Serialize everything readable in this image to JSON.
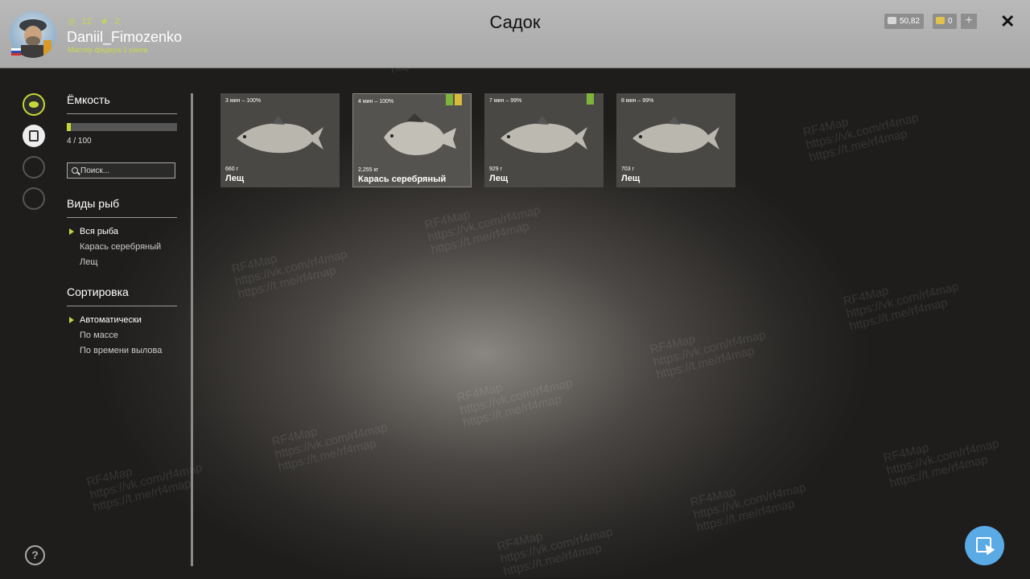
{
  "player": {
    "level": "12",
    "stars": "2",
    "username": "Daniil_Fimozenko",
    "rank": "Мастер фидера 1 ранга"
  },
  "title": "Садок",
  "currency": {
    "silver": "50,82",
    "gold": "0",
    "add": "+"
  },
  "capacity": {
    "title": "Ёмкость",
    "used": 4,
    "max": 100,
    "text": "4 / 100"
  },
  "search": {
    "placeholder": "Поиск..."
  },
  "fish_types": {
    "title": "Виды рыб",
    "items": [
      "Вся рыба",
      "Карась серебряный",
      "Лещ"
    ]
  },
  "sorting": {
    "title": "Сортировка",
    "items": [
      "Автоматически",
      "По массе",
      "По времени вылова"
    ]
  },
  "cards": [
    {
      "time": "3 мин – 100%",
      "weight": "660 г",
      "name": "Лещ"
    },
    {
      "time": "4 мин – 100%",
      "weight": "2,255 кг",
      "name": "Карась серебряный"
    },
    {
      "time": "7 мин – 99%",
      "weight": "929 г",
      "name": "Лещ"
    },
    {
      "time": "8 мин – 99%",
      "weight": "703 г",
      "name": "Лещ"
    }
  ],
  "watermark": {
    "name": "RF4Map",
    "vk": "https://vk.com/rf4map",
    "tg": "https://t.me/rf4map"
  },
  "colors": {
    "accent": "#c6d63a",
    "topbar": "#b0b0b0",
    "help_button": "#5aaae6"
  },
  "icons": [
    "fish-icon",
    "keepnet-icon",
    "trophy-icon",
    "home-icon",
    "help-icon",
    "cursor-icon",
    "close-icon",
    "search-icon"
  ]
}
